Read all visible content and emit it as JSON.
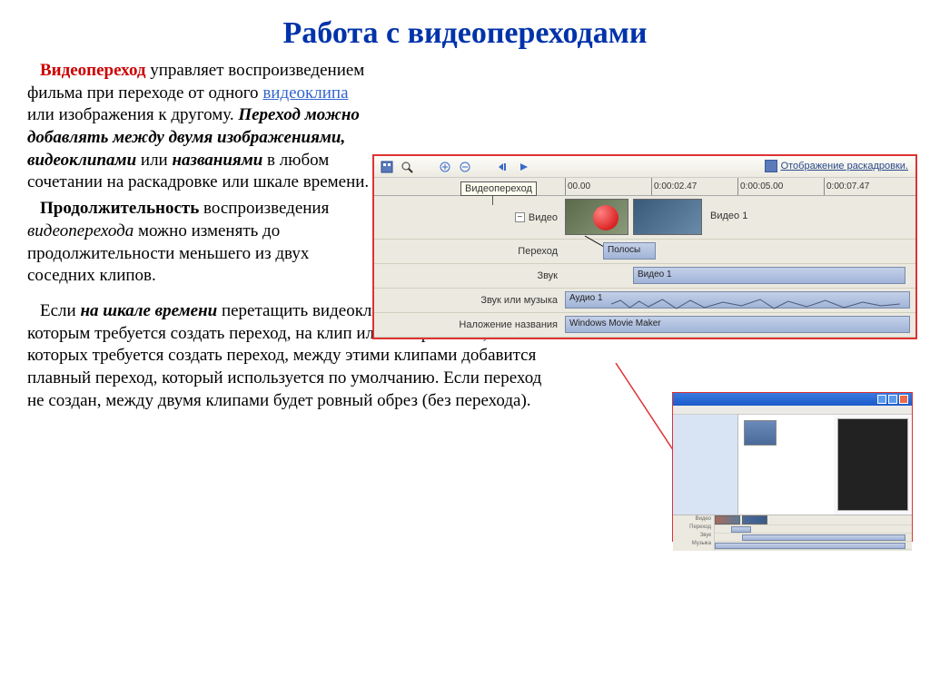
{
  "title": "Работа с видеопереходами",
  "para1": {
    "term": "Видеопереход",
    "t1": " управляет воспроизведением фильма при переходе от одного ",
    "link": "видеоклипа",
    "t2": " или изображения к другому. ",
    "bi": "Переход можно добавлять между двумя изображениями, видеоклипами",
    "t3": " или ",
    "bi2": "названиями",
    "t4": " в любом сочетании на раскадровке или шкале времени."
  },
  "para2": {
    "b": "Продолжительность",
    "t1": " воспроизведения ",
    "i": "видеоперехода",
    "t2": " можно изменять до продолжительности меньшего из двух соседних клипов."
  },
  "para3": {
    "t1": "Если ",
    "bi": "на шкале времени",
    "t2": " перетащить видеоклип или изображение, к которым требуется создать переход, на клип или изображение, из которых требуется создать переход, между этими клипами добавится плавный переход, который используется по умолчанию. Если переход не создан, между двумя клипами будет ровный обрез (без перехода)."
  },
  "shot1": {
    "storyboard_link": "Отображение раскадровки.",
    "callout": "Видеопереход",
    "ruler": [
      "00.00",
      "0:00:02.47",
      "0:00:05.00",
      "0:00:07.47"
    ],
    "tracks": {
      "video": "Видео",
      "transition": "Переход",
      "sound": "Звук",
      "music": "Звук или музыка",
      "overlay": "Наложение названия"
    },
    "clips": {
      "video_label": "Видео 1",
      "transition_name": "Полосы",
      "sound_label": "Видео 1",
      "audio_label": "Аудио 1",
      "title_label": "Windows Movie Maker"
    }
  },
  "shot2": {
    "tl_labels": [
      "Видео",
      "Переход",
      "Звук",
      "Музыка"
    ]
  }
}
